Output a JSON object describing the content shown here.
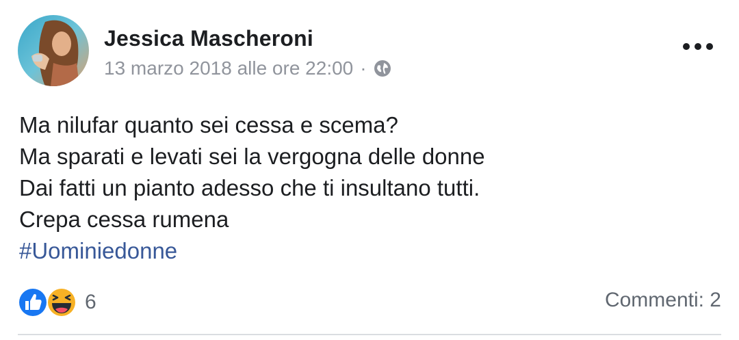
{
  "post": {
    "author": "Jessica Mascheroni",
    "timestamp": "13 marzo 2018 alle ore 22:00",
    "separator": "·",
    "privacy_icon": "globe-icon",
    "menu_icon": "more-options-icon",
    "lines": [
      "Ma nilufar quanto sei cessa e scema?",
      "Ma sparati e levati sei la vergogna delle donne",
      "Dai fatti un pianto adesso che ti insultano tutti.",
      "Crepa cessa rumena"
    ],
    "hashtag": "#Uominiedonne"
  },
  "footer": {
    "reaction_icons": [
      "like-icon",
      "haha-icon"
    ],
    "reaction_count": "6",
    "comments_label": "Commenti: 2"
  },
  "colors": {
    "text": "#1c1e21",
    "meta": "#90949c",
    "hashtag": "#385898",
    "like_blue": "#1877f2",
    "haha_yellow": "#f7b125"
  }
}
